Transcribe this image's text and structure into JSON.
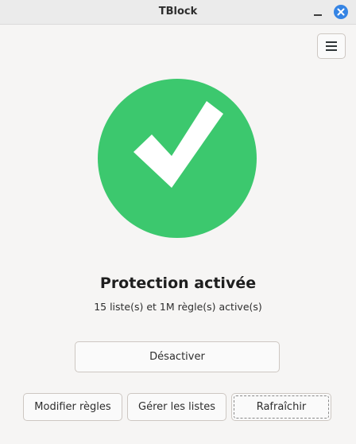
{
  "window": {
    "title": "TBlock"
  },
  "colors": {
    "status_ok": "#3cc86e",
    "accent": "#3584e4"
  },
  "icons": {
    "menu": "hamburger-menu-icon",
    "status": "checkmark-icon",
    "close": "close-icon",
    "minimize": "minimize-icon"
  },
  "status": {
    "title": "Protection activée",
    "subtitle": "15 liste(s) et 1M règle(s) active(s)"
  },
  "actions": {
    "deactivate_label": "Désactiver",
    "edit_rules_label": "Modifier règles",
    "manage_lists_label": "Gérer les listes",
    "refresh_label": "Rafraîchir"
  }
}
